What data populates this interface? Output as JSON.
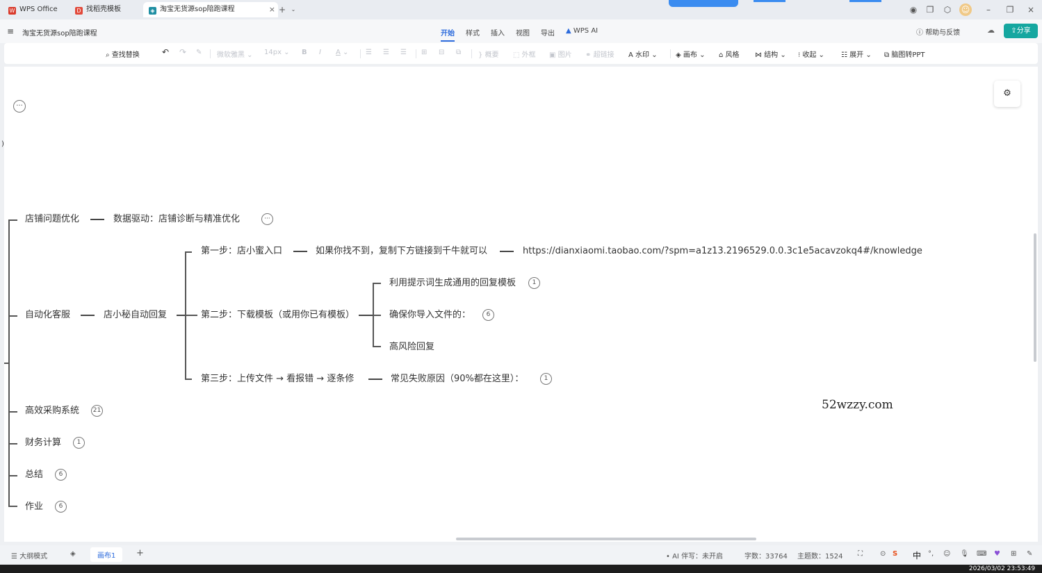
{
  "tabs": [
    {
      "label": "WPS Office",
      "icon": "wps-logo-icon",
      "color": "#d93a2b"
    },
    {
      "label": "找稻壳模板",
      "icon": "docer-icon",
      "color": "#e24a3b"
    },
    {
      "label": "淘宝无货源sop陪跑课程",
      "icon": "mindmap-doc-icon",
      "color": "#1f8fa3"
    }
  ],
  "menubar": {
    "doc_title": "淘宝无货源sop陪跑课程",
    "tabs": [
      "开始",
      "样式",
      "插入",
      "视图",
      "导出",
      "WPS AI"
    ],
    "active_tab": "开始",
    "help": "帮助与反馈",
    "share": "分享"
  },
  "toolbar": {
    "find_replace": "查找替换",
    "font": "微软雅黑",
    "font_size": "14px",
    "summary": "概要",
    "outline": "外框",
    "image": "图片",
    "hyperlink": "超链接",
    "watermark": "水印",
    "canvas": "画布",
    "style": "风格",
    "structure": "结构",
    "collapse": "收起",
    "expand": "展开",
    "to_ppt": "脑图转PPT"
  },
  "mindmap": {
    "n1": "店铺问题优化",
    "n1a": "数据驱动：店铺诊断与精准优化",
    "n2": "自动化客服",
    "n2a": "店小秘自动回复",
    "s1": "第一步：店小蜜入口",
    "s1a": "如果你找不到，复制下方链接到千牛就可以",
    "s1b": "https://dianxiaomi.taobao.com/?spm=a1z13.2196529.0.0.3c1e5acavzokq4#/knowledge",
    "s2": "第二步：下载模板（或用你已有模板）",
    "s2a": "利用提示词生成通用的回复模板",
    "s2a_count": "1",
    "s2b": "确保你导入文件的：",
    "s2b_count": "6",
    "s2c": "高风险回复",
    "s3": "第三步：上传文件 → 看报错 → 逐条修",
    "s3a": "常见失败原因（90%都在这里）：",
    "s3a_count": "1",
    "n3": "高效采购系统",
    "n3_count": "21",
    "n4": "财务计算",
    "n4_count": "1",
    "n5": "总结",
    "n5_count": "6",
    "n6": "作业",
    "n6_count": "6"
  },
  "watermark_text": "52wzzy.com",
  "statusbar": {
    "outline_mode": "大纲模式",
    "canvas_tab": "画布1",
    "ai_status": "AI 伴写：未开启",
    "word_count": "字数：33764",
    "topic_count": "主题数：1524",
    "ime_lang": "中"
  },
  "clock": "2026/03/02 23:53:49"
}
